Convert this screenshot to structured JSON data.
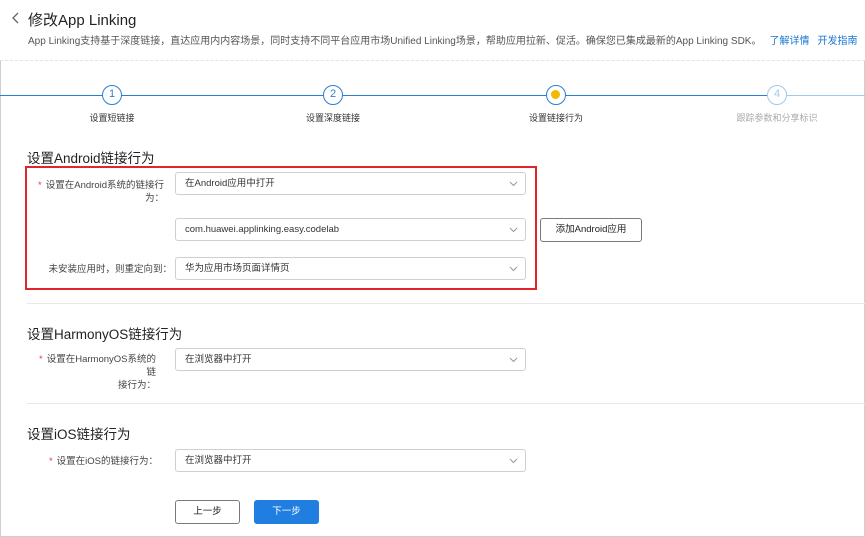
{
  "header": {
    "title": "修改App Linking",
    "description": "App Linking支持基于深度链接，直达应用内内容场景，同时支持不同平台应用市场Unified Linking场景，帮助应用拉新、促活。确保您已集成最新的App Linking SDK。",
    "link_details": "了解详情",
    "link_guide": "开发指南"
  },
  "steps": [
    {
      "number": "1",
      "label": "设置短链接"
    },
    {
      "number": "2",
      "label": "设置深度链接"
    },
    {
      "number": "",
      "label": "设置链接行为"
    },
    {
      "number": "4",
      "label": "跟踪参数和分享标识"
    }
  ],
  "android": {
    "title": "设置Android链接行为",
    "behavior_label": "设置在Android系统的链接行为：",
    "behavior_value": "在Android应用中打开",
    "package_value": "com.huawei.applinking.easy.codelab",
    "add_app_button": "添加Android应用",
    "redirect_label": "未安装应用时，则重定向到：",
    "redirect_value": "华为应用市场页面详情页"
  },
  "harmony": {
    "title": "设置HarmonyOS链接行为",
    "behavior_label_line1": "设置在HarmonyOS系统的链",
    "behavior_label_line2": "接行为：",
    "behavior_value": "在浏览器中打开"
  },
  "ios": {
    "title": "设置iOS链接行为",
    "behavior_label": "设置在iOS的链接行为：",
    "behavior_value": "在浏览器中打开"
  },
  "footer": {
    "prev_button": "上一步",
    "next_button": "下一步"
  },
  "colors": {
    "primary": "#1f7ee0",
    "step_active": "#2a7fd4",
    "step_inactive": "#9fcaee",
    "current_dot": "#f5b800",
    "highlight": "#e0262b",
    "required": "#e23b3b"
  }
}
